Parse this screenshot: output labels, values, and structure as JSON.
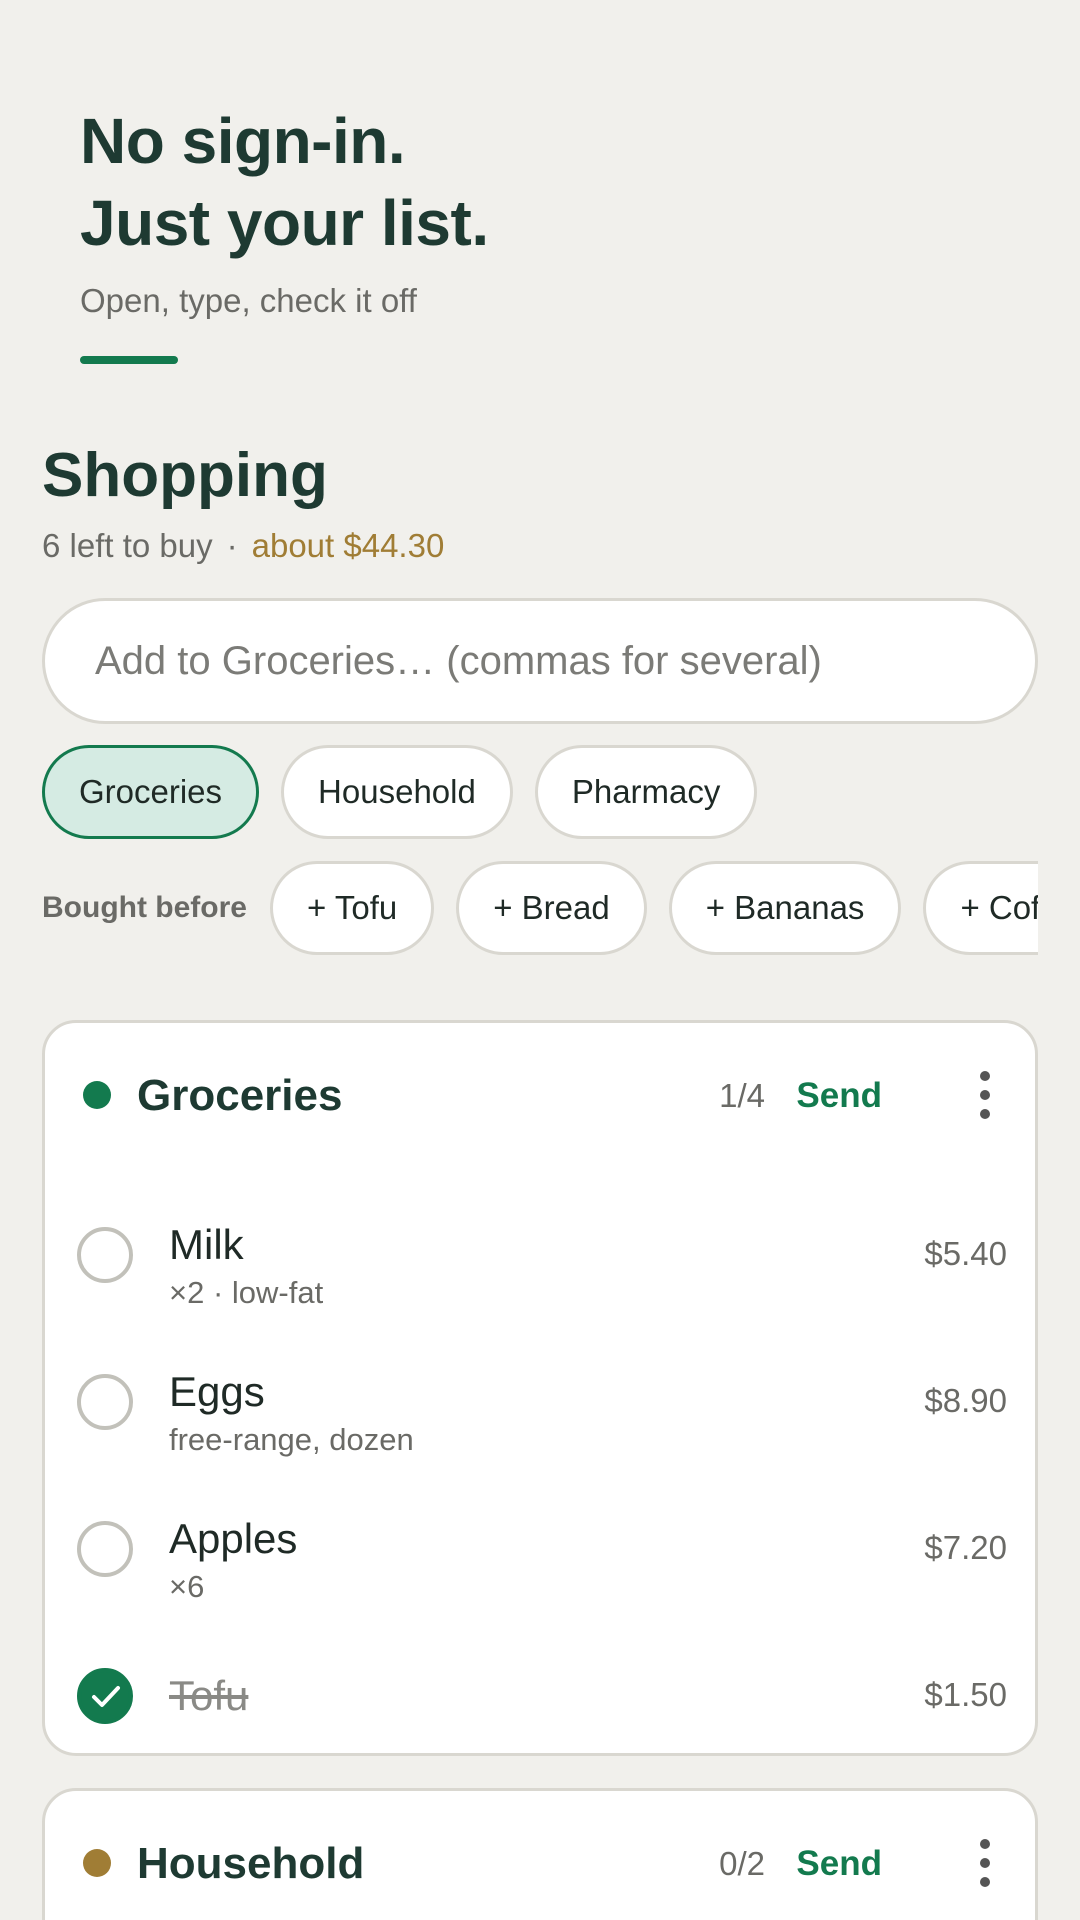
{
  "hero": {
    "line1": "No sign-in.",
    "line2": "Just your list.",
    "subtitle": "Open, type, check it off"
  },
  "shopping": {
    "title": "Shopping",
    "left_to_buy": "6 left to buy",
    "separator": "·",
    "estimate": "about $44.30"
  },
  "add_input": {
    "placeholder": "Add to Groceries… (commas for several)"
  },
  "category_chips": [
    {
      "label": "Groceries",
      "selected": true
    },
    {
      "label": "Household",
      "selected": false
    },
    {
      "label": "Pharmacy",
      "selected": false
    }
  ],
  "bought_before": {
    "label": "Bought before",
    "items": [
      "+ Tofu",
      "+ Bread",
      "+ Bananas",
      "+ Coffee"
    ]
  },
  "lists": [
    {
      "name": "Groceries",
      "color": "#137a4e",
      "count": "1/4",
      "send_label": "Send",
      "items": [
        {
          "name": "Milk",
          "note": "×2 · low-fat",
          "price": "$5.40",
          "checked": false
        },
        {
          "name": "Eggs",
          "note": "free-range, dozen",
          "price": "$8.90",
          "checked": false
        },
        {
          "name": "Apples",
          "note": "×6",
          "price": "$7.20",
          "checked": false
        },
        {
          "name": "Tofu",
          "note": "",
          "price": "$1.50",
          "checked": true
        }
      ]
    },
    {
      "name": "Household",
      "color": "#a07d35",
      "count": "0/2",
      "send_label": "Send",
      "items": []
    }
  ],
  "colors": {
    "accent": "#137a4e",
    "estimate": "#a07d35",
    "background": "#f1f0ec"
  },
  "icons": {
    "more": "more-vertical-icon",
    "check": "checkmark-icon"
  }
}
